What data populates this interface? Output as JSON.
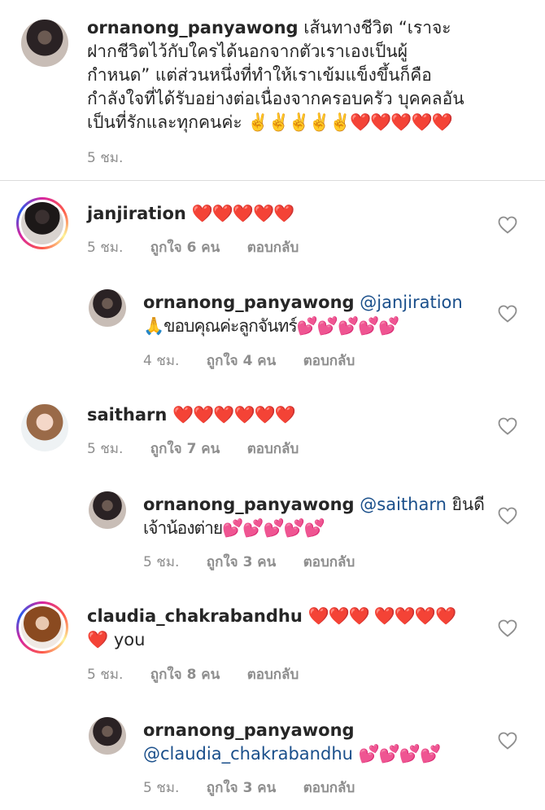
{
  "caption": {
    "username": "ornanong_panyawong",
    "text": "เส้นทางชีวิต “เราจะฝากชีวิตไว้กับใครได้นอกจากตัวเราเองเป็นผู้กำหนด” แต่ส่วนหนึ่งที่ทำให้เราเข้มแข็งขึ้นก็คือกำลังใจที่ได้รับอย่างต่อเนื่องจากครอบครัว บุคคลอันเป็นที่รักและทุกคนค่ะ",
    "emoji": "✌️✌️✌️✌️✌️❤️❤️❤️❤️❤️",
    "time": "5 ชม."
  },
  "comments": [
    {
      "username": "janjiration",
      "text": "❤️❤️❤️❤️❤️",
      "time": "5 ชม.",
      "likes_label": "ถูกใจ",
      "likes": "6 คน",
      "reply_label": "ตอบกลับ"
    },
    {
      "username": "ornanong_panyawong",
      "mention": "@janjiration",
      "text": "🙏ขอบคุณค่ะลูกจันทร์💕💕💕💕💕",
      "time": "4 ชม.",
      "likes_label": "ถูกใจ",
      "likes": "4 คน",
      "reply_label": "ตอบกลับ"
    },
    {
      "username": "saitharn",
      "text": "❤️❤️❤️❤️❤️❤️",
      "time": "5 ชม.",
      "likes_label": "ถูกใจ",
      "likes": "7 คน",
      "reply_label": "ตอบกลับ"
    },
    {
      "username": "ornanong_panyawong",
      "mention": "@saitharn",
      "text_line1": "ยินดี",
      "text_line2": "เจ้าน้องต่าย💕💕💕💕💕",
      "time": "5 ชม.",
      "likes_label": "ถูกใจ",
      "likes": "3 คน",
      "reply_label": "ตอบกลับ"
    },
    {
      "username": "claudia_chakrabandhu",
      "text": "❤️❤️❤️ ❤️❤️❤️❤️",
      "text_line2": "❤️ you",
      "time": "5 ชม.",
      "likes_label": "ถูกใจ",
      "likes": "8 คน",
      "reply_label": "ตอบกลับ"
    },
    {
      "username": "ornanong_panyawong",
      "mention": "@claudia_chakrabandhu",
      "text": "💕💕💕💕",
      "time": "5 ชม.",
      "likes_label": "ถูกใจ",
      "likes": "3 คน",
      "reply_label": "ตอบกลับ"
    }
  ]
}
